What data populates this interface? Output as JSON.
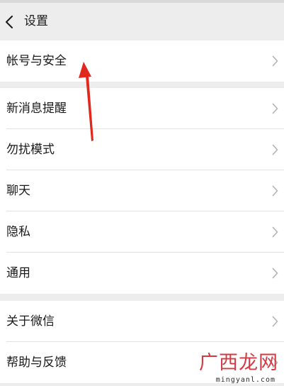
{
  "nav": {
    "title": "设置",
    "back_icon": "chevron-left-icon"
  },
  "groups": [
    {
      "items": [
        {
          "label": "帐号与安全",
          "icon": "chevron-right-icon"
        }
      ]
    },
    {
      "items": [
        {
          "label": "新消息提醒",
          "icon": "chevron-right-icon"
        },
        {
          "label": "勿扰模式",
          "icon": "chevron-right-icon"
        },
        {
          "label": "聊天",
          "icon": "chevron-right-icon"
        },
        {
          "label": "隐私",
          "icon": "chevron-right-icon"
        },
        {
          "label": "通用",
          "icon": "chevron-right-icon"
        }
      ]
    },
    {
      "items": [
        {
          "label": "关于微信",
          "icon": "chevron-right-icon"
        },
        {
          "label": "帮助与反馈",
          "icon": "chevron-right-icon"
        }
      ]
    }
  ],
  "watermark": {
    "main": "广西龙网",
    "sub": "mingyanl.com"
  },
  "colors": {
    "background": "#ededed",
    "row_background": "#ffffff",
    "text": "#1a1a1a",
    "chevron": "#b2b2b2",
    "annotation_arrow": "#e0281c",
    "watermark": "#cf1f2a"
  }
}
